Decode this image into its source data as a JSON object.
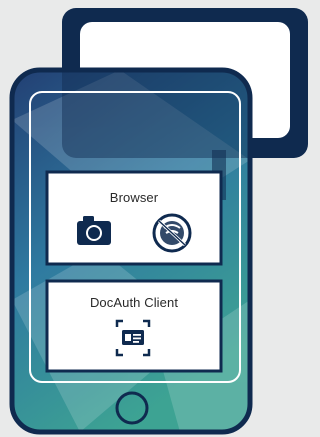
{
  "colors": {
    "background": "#e9eaea",
    "navy": "#0f2a4f",
    "phone_gradient_top": "#223f73",
    "phone_gradient_mid": "#2f7aa0",
    "phone_gradient_bottom": "#3da393",
    "panel_fill": "#ffffff",
    "panel_border": "#0f2a4f"
  },
  "browser_panel": {
    "label": "Browser",
    "icons": [
      "camera-icon",
      "no-signal-icon"
    ]
  },
  "docauth_panel": {
    "label": "DocAuth Client",
    "icons": [
      "id-card-scan-icon"
    ]
  },
  "decorations": [
    "monitor-icon",
    "smartphone",
    "home-button"
  ]
}
